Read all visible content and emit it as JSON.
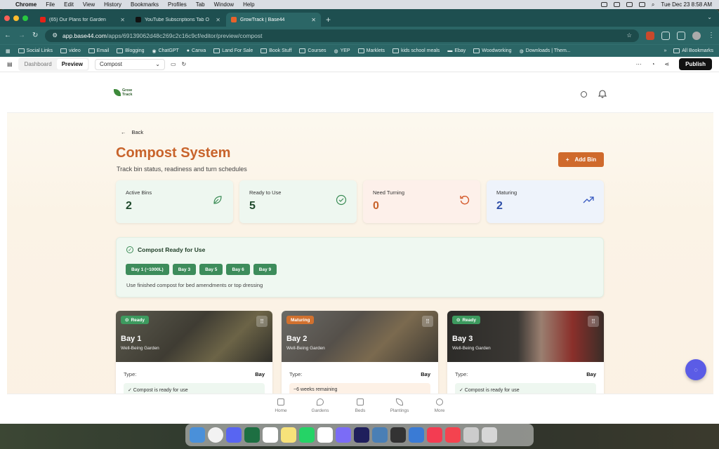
{
  "menubar": {
    "app": "Chrome",
    "items": [
      "File",
      "Edit",
      "View",
      "History",
      "Bookmarks",
      "Profiles",
      "Tab",
      "Window",
      "Help"
    ],
    "clock": "Tue Dec 23  8:58 AM"
  },
  "browser": {
    "tabs": [
      {
        "title": "(65) Our Plans for Garden",
        "color": "#e62117"
      },
      {
        "title": "YouTube Subscriptions Tab O",
        "color": "#111111"
      },
      {
        "title": "GrowTrack | Base44",
        "color": "#e8622a"
      }
    ],
    "url_host": "app.base44.com",
    "url_path": "/apps/69139062d48c269c2c16c9cf/editor/preview/compost",
    "bookmarks": [
      "Social Links",
      "video",
      "Email",
      "Blogging",
      "ChatGPT",
      "Canva",
      "Land For Sale",
      "Book Stuff",
      "Courses",
      "YEP",
      "Marklets",
      "kids school meals",
      "Ebay",
      "Woodworking",
      "Downloads | Them..."
    ],
    "all_bookmarks": "All Bookmarks"
  },
  "editor": {
    "dashboard": "Dashboard",
    "preview": "Preview",
    "page": "Compost",
    "publish": "Publish"
  },
  "app": {
    "logo_line1": "Grow",
    "logo_line2": "Track",
    "back": "Back",
    "title": "Compost System",
    "subtitle": "Track bin status, readiness and turn schedules",
    "add_bin": "Add Bin",
    "stats": [
      {
        "label": "Active Bins",
        "value": "2",
        "bg": "#eef7f0",
        "color": "#1f4a2c",
        "icon": "leaf-icon"
      },
      {
        "label": "Ready to Use",
        "value": "5",
        "bg": "#eef7f0",
        "color": "#1f4a2c",
        "icon": "check-circle-icon"
      },
      {
        "label": "Need Turning",
        "value": "0",
        "bg": "#fdf0ea",
        "color": "#c8632b",
        "icon": "rotate-icon"
      },
      {
        "label": "Maturing",
        "value": "2",
        "bg": "#eef3fb",
        "color": "#2f4fa8",
        "icon": "trending-up-icon"
      }
    ],
    "ready_panel": {
      "title": "Compost Ready for Use",
      "chips": [
        "Bay 1 (~1000L)",
        "Bay 3",
        "Bay 5",
        "Bay 6",
        "Bay 9"
      ],
      "note": "Use finished compost for bed amendments or top dressing"
    },
    "bins": [
      {
        "badge": "Ready",
        "badge_color": "#3d9a5f",
        "name": "Bay 1",
        "garden": "Well-Being Garden",
        "type_label": "Type:",
        "type_value": "Bay",
        "note": "✓ Compost is ready for use",
        "note_bg": "#eef7f0"
      },
      {
        "badge": "Maturing",
        "badge_color": "#d1712f",
        "name": "Bay 2",
        "garden": "Well-Being Garden",
        "type_label": "Type:",
        "type_value": "Bay",
        "note": "~6 weeks remaining",
        "note_bg": "#fdf1e6"
      },
      {
        "badge": "Ready",
        "badge_color": "#3d9a5f",
        "name": "Bay 3",
        "garden": "Well-Being Garden",
        "type_label": "Type:",
        "type_value": "Bay",
        "note": "✓ Compost is ready for use",
        "note_bg": "#eef7f0"
      }
    ],
    "nav": [
      "Home",
      "Gardens",
      "Beds",
      "Plantings",
      "More"
    ]
  }
}
